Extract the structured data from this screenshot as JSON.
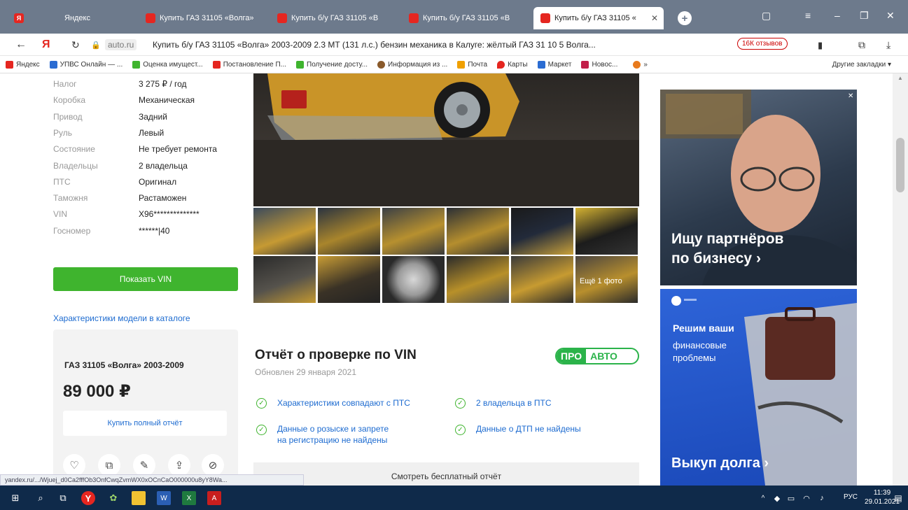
{
  "browser": {
    "tabs": [
      {
        "label": "Яндекс",
        "fav_color": "#e52620"
      },
      {
        "label": "Купить ГАЗ 31105 «Волга»",
        "fav_color": "#e52620"
      },
      {
        "label": "Купить б/у ГАЗ 31105 «В",
        "fav_color": "#e52620"
      },
      {
        "label": "Купить б/у ГАЗ 31105 «В",
        "fav_color": "#e52620"
      },
      {
        "label": "Купить б/у ГАЗ 31105 «",
        "fav_color": "#e52620"
      }
    ],
    "address_domain": "auto.ru",
    "address_title": "Купить б/у ГАЗ 31105 «Волга» 2003-2009 2.3 MT (131 л.с.) бензин механика в Калуге: жёлтый ГАЗ 31 10 5 Волга...",
    "reviews_badge": "16К отзывов",
    "bookmarks": [
      {
        "label": "Яндекс",
        "color": "#e52620"
      },
      {
        "label": "УПВС Онлайн — ...",
        "color": "#2b6cd2"
      },
      {
        "label": "Оценка имущест...",
        "color": "#3fb42e"
      },
      {
        "label": "Постановление П...",
        "color": "#e52620"
      },
      {
        "label": "Получение досту...",
        "color": "#3fb42e"
      },
      {
        "label": "Информация из ...",
        "color": "#8a5a2b"
      },
      {
        "label": "Почта",
        "color": "#f0a000"
      },
      {
        "label": "Карты",
        "color": "#e52620"
      },
      {
        "label": "Маркет",
        "color": "#2b6cd2"
      },
      {
        "label": "Новос...",
        "color": "#c21f4a"
      },
      {
        "label": "»",
        "color": "#ffffff"
      },
      {
        "label": "Другие закладки ▾",
        "color": "#ffffff"
      }
    ]
  },
  "specs": [
    {
      "label": "Налог",
      "value": "3 275 ₽ / год"
    },
    {
      "label": "Коробка",
      "value": "Механическая"
    },
    {
      "label": "Привод",
      "value": "Задний"
    },
    {
      "label": "Руль",
      "value": "Левый"
    },
    {
      "label": "Состояние",
      "value": "Не требует ремонта"
    },
    {
      "label": "Владельцы",
      "value": "2 владельца"
    },
    {
      "label": "ПТС",
      "value": "Оригинал"
    },
    {
      "label": "Таможня",
      "value": "Растаможен"
    },
    {
      "label": "VIN",
      "value": "X96**************"
    },
    {
      "label": "Госномер",
      "value": "******|40"
    }
  ],
  "show_vin_label": "Показать VIN",
  "catalog_link": "Характеристики модели в каталоге",
  "card": {
    "title": "ГАЗ 31105 «Волга» 2003-2009",
    "price": "89 000 ₽",
    "buy_report": "Купить полный отчёт",
    "icons": [
      "♡",
      "⧉",
      "✎",
      "⇪",
      "⊘"
    ]
  },
  "gallery": {
    "more_label": "Ещё 1 фото"
  },
  "vin_report": {
    "title": "Отчёт о проверке по VIN",
    "updated": "Обновлен 29 января 2021",
    "badge_left": "ПРО",
    "badge_right": "АВТО",
    "checks": [
      "Характеристики совпадают с ПТС",
      "2 владельца в ПТС",
      "Данные о розыске и запрете\nна регистрацию не найдены",
      "Данные о ДТП не найдены"
    ],
    "free_report": "Смотреть бесплатный отчёт"
  },
  "ads": {
    "ad1_text": "Ищу партнёров\nпо бизнесу ›",
    "ad2_line1": "Решим ваши",
    "ad2_line2": "финансовые\nпроблемы",
    "ad2_line3": "Выкуп долга ›"
  },
  "status_url": "yandex.ru/.../Wjuej_d0Ca2fffOb3OnfCwqZvmWX0xOCnCaO000000u8yY8Wa...",
  "taskbar": {
    "lang": "РУС",
    "time": "11:39",
    "date": "29.01.2021"
  }
}
